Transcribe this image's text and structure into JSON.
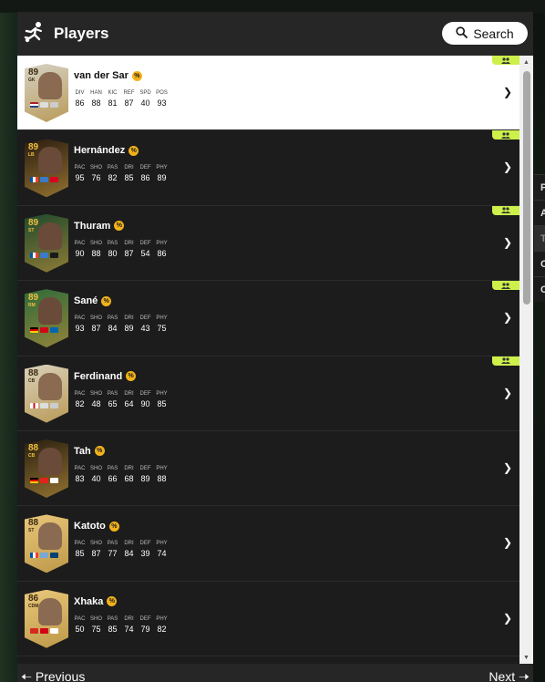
{
  "header": {
    "title": "Players",
    "search_label": "Search"
  },
  "side_menu": [
    "P",
    "A",
    "T",
    "C",
    "C"
  ],
  "footer": {
    "prev_label": "Previous",
    "next_label": "Next"
  },
  "players": [
    {
      "name": "van der Sar",
      "rating": "89",
      "position": "GK",
      "card_color": "#d6d2c4",
      "labels": [
        "DIV",
        "HAN",
        "KIC",
        "REF",
        "SPD",
        "POS"
      ],
      "values": [
        "86",
        "88",
        "81",
        "87",
        "40",
        "93"
      ]
    },
    {
      "name": "Hernández",
      "rating": "89",
      "position": "LB",
      "card_color": "#2a1c10",
      "labels": [
        "PAC",
        "SHO",
        "PAS",
        "DRI",
        "DEF",
        "PHY"
      ],
      "values": [
        "95",
        "76",
        "82",
        "85",
        "86",
        "89"
      ]
    },
    {
      "name": "Thuram",
      "rating": "89",
      "position": "ST",
      "card_color": "#1f4a2c",
      "labels": [
        "PAC",
        "SHO",
        "PAS",
        "DRI",
        "DEF",
        "PHY"
      ],
      "values": [
        "90",
        "88",
        "80",
        "87",
        "54",
        "86"
      ]
    },
    {
      "name": "Sané",
      "rating": "89",
      "position": "RM",
      "card_color": "#2f6b3a",
      "labels": [
        "PAC",
        "SHO",
        "PAS",
        "DRI",
        "DEF",
        "PHY"
      ],
      "values": [
        "93",
        "87",
        "84",
        "89",
        "43",
        "75"
      ]
    },
    {
      "name": "Ferdinand",
      "rating": "88",
      "position": "CB",
      "card_color": "#d9d1ba",
      "labels": [
        "PAC",
        "SHO",
        "PAS",
        "DRI",
        "DEF",
        "PHY"
      ],
      "values": [
        "82",
        "48",
        "65",
        "64",
        "90",
        "85"
      ]
    },
    {
      "name": "Tah",
      "rating": "88",
      "position": "CB",
      "card_color": "#2a2010",
      "labels": [
        "PAC",
        "SHO",
        "PAS",
        "DRI",
        "DEF",
        "PHY"
      ],
      "values": [
        "83",
        "40",
        "66",
        "68",
        "89",
        "88"
      ]
    },
    {
      "name": "Katoto",
      "rating": "88",
      "position": "ST",
      "card_color": "#e9c77a",
      "labels": [
        "PAC",
        "SHO",
        "PAS",
        "DRI",
        "DEF",
        "PHY"
      ],
      "values": [
        "85",
        "87",
        "77",
        "84",
        "39",
        "74"
      ]
    },
    {
      "name": "Xhaka",
      "rating": "86",
      "position": "CDM",
      "card_color": "#e9c77a",
      "labels": [
        "PAC",
        "SHO",
        "PAS",
        "DRI",
        "DEF",
        "PHY"
      ],
      "values": [
        "50",
        "75",
        "85",
        "74",
        "79",
        "82"
      ]
    }
  ]
}
